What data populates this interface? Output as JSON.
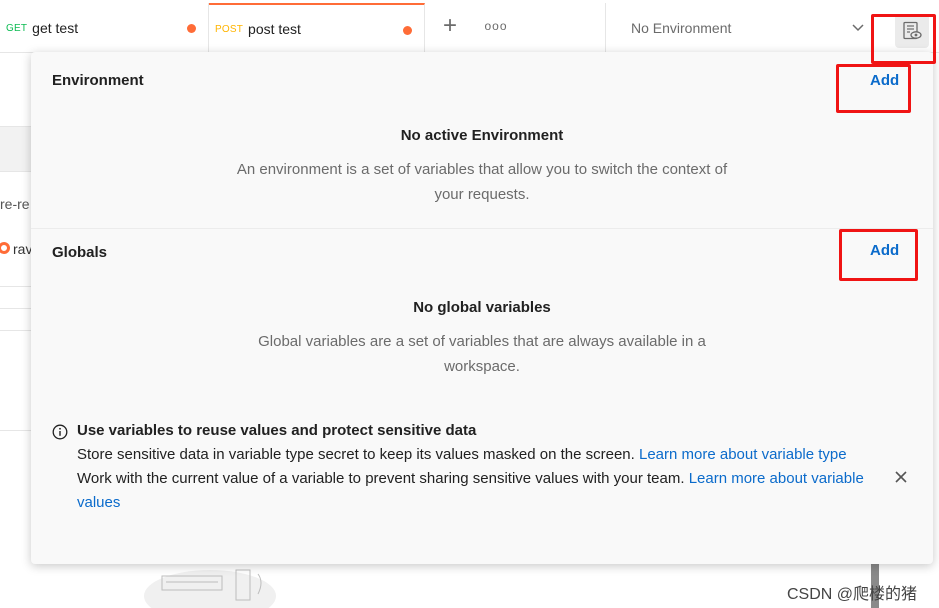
{
  "tabs": [
    {
      "method": "GET",
      "title": "get test"
    },
    {
      "method": "POST",
      "title": "post test"
    }
  ],
  "toolbar": {
    "new_tab_symbol": "+",
    "more_symbol": "ooo",
    "environment_selected": "No Environment"
  },
  "background": {
    "fragment_1": "re-re",
    "fragment_2": "rav"
  },
  "environment": {
    "heading": "Environment",
    "add_label": "Add",
    "empty_title": "No active Environment",
    "empty_desc": "An environment is a set of variables that allow you to switch the context of your requests."
  },
  "globals": {
    "heading": "Globals",
    "add_label": "Add",
    "empty_title": "No global variables",
    "empty_desc": "Global variables are a set of variables that are always available in a workspace."
  },
  "info": {
    "title": "Use variables to reuse values and protect sensitive data",
    "line1": "Store sensitive data in variable type secret to keep its values masked on the screen.",
    "link1": "Learn more about variable type",
    "line2": "Work with the current value of a variable to prevent sharing sensitive values with your team.",
    "link2": "Learn more about variable values"
  },
  "watermark": "CSDN @爬楼的猪",
  "colors": {
    "accent_orange": "#ff6c37",
    "link_blue": "#0b6bcb",
    "annotation_red": "#f01414"
  },
  "icons": {
    "quicklook": "eye-document-icon",
    "info": "info-circle-icon",
    "close": "close-x-icon",
    "chevron": "chevron-down-icon"
  }
}
